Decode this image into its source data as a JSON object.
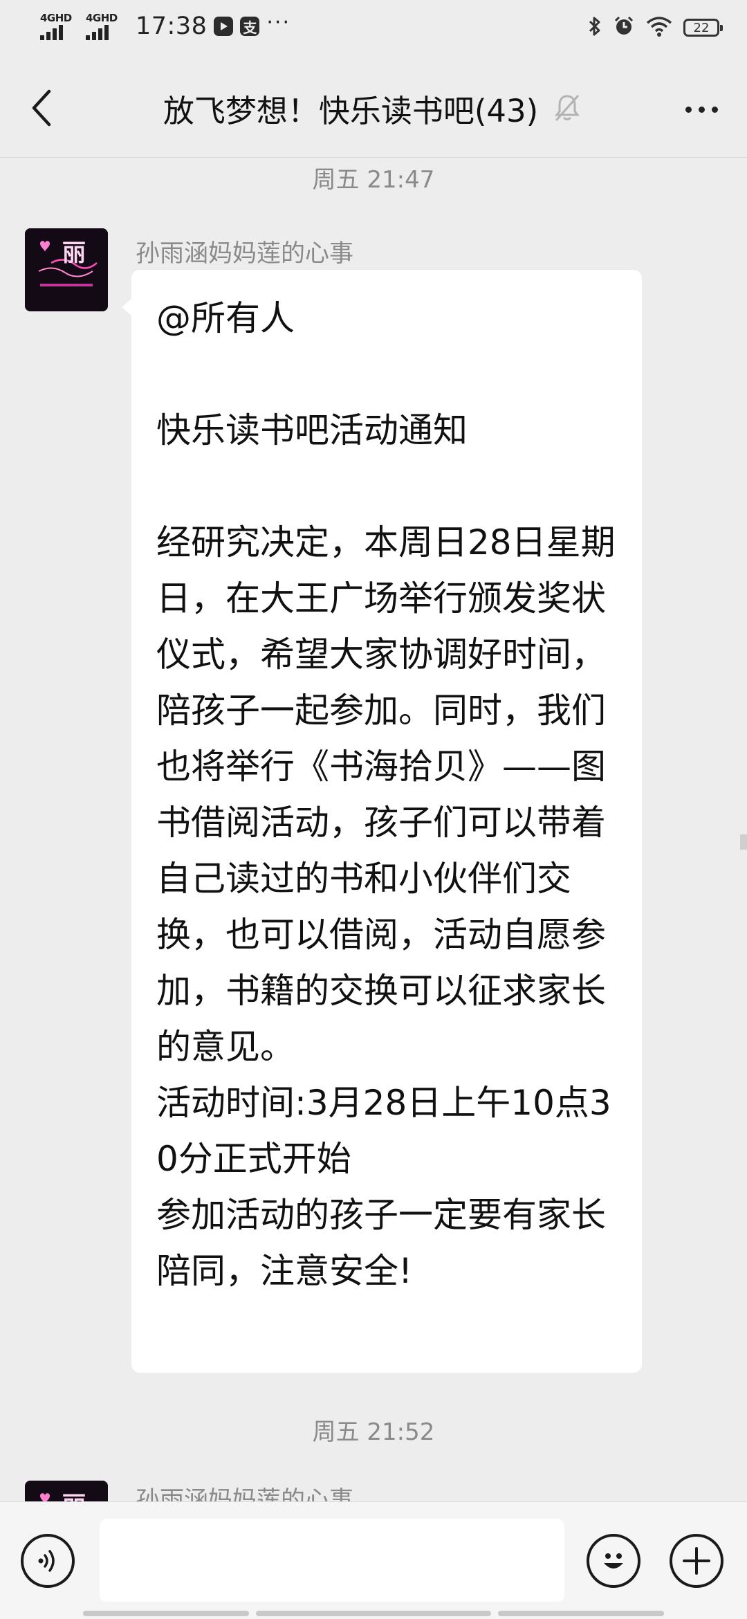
{
  "status_bar": {
    "network_1": "4GHD",
    "network_2": "4GHD",
    "time": "17:38",
    "app_icon_text": "支",
    "more": "···",
    "battery": "22"
  },
  "nav": {
    "title": "放飞梦想！快乐读书吧(43)"
  },
  "messages": [
    {
      "timestamp": "周五 21:47",
      "sender": "孙雨涵妈妈莲的心事",
      "avatar_text": "丽",
      "text": "@所有人\n\n快乐读书吧活动通知\n\n经研究决定，本周日28日星期日，在大王广场举行颁发奖状仪式，希望大家协调好时间，陪孩子一起参加。同时，我们也将举行《书海拾贝》——图书借阅活动，孩子们可以带着自己读过的书和小伙伴们交换，也可以借阅，活动自愿参加，书籍的交换可以征求家长的意见。\n活动时间:3月28日上午10点30分正式开始\n参加活动的孩子一定要有家长陪同，注意安全!"
    },
    {
      "timestamp": "周五 21:52",
      "sender": "孙雨涵妈妈莲的心事",
      "avatar_text": "丽"
    }
  ],
  "input": {
    "placeholder": ""
  },
  "colors": {
    "background": "#ededed",
    "bubble": "#ffffff",
    "meta_text": "#8a8a8a",
    "avatar_glow": "#ff3fa8"
  }
}
